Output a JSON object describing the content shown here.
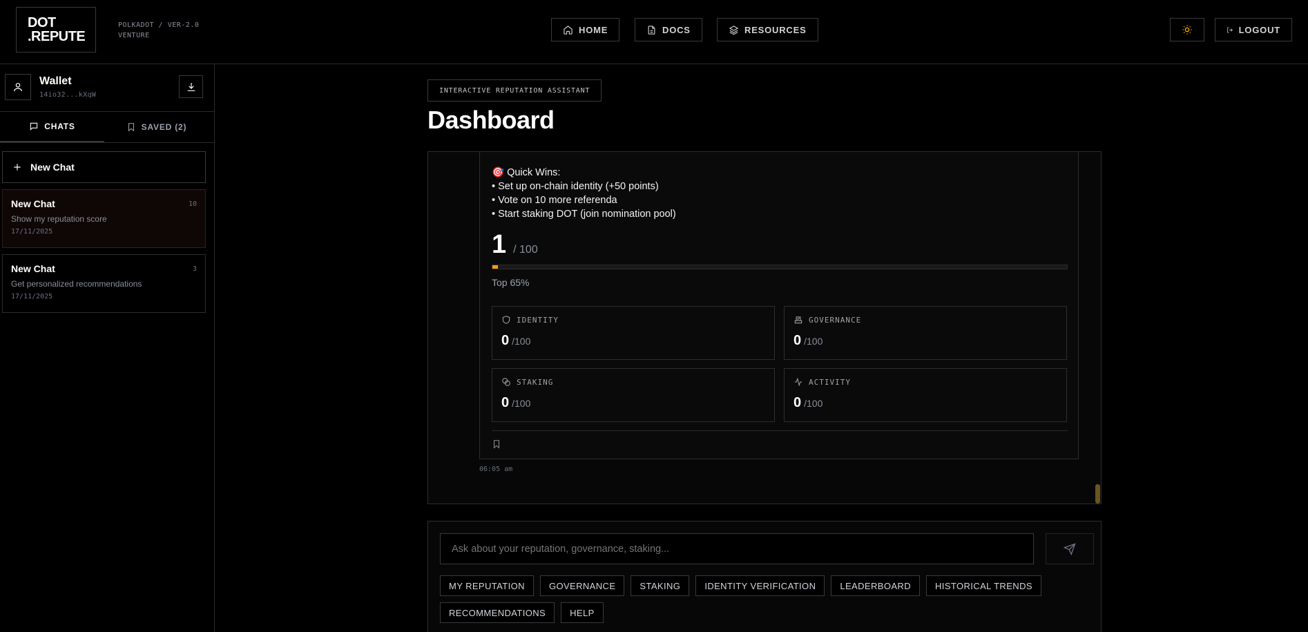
{
  "brand": {
    "line1": "DOT",
    "line2": ".REPUTE",
    "sub1": "POLKADOT / VER-2.0",
    "sub2": "VENTURE"
  },
  "nav": {
    "home": "HOME",
    "docs": "DOCS",
    "resources": "RESOURCES",
    "logout": "LOGOUT"
  },
  "wallet": {
    "title": "Wallet",
    "address": "14io32...kXqW"
  },
  "tabs": {
    "chats": "CHATS",
    "saved": "SAVED (2)"
  },
  "new_chat": "New Chat",
  "chats": [
    {
      "title": "New Chat",
      "subtitle": "Show my reputation score",
      "date": "17/11/2025",
      "count": "10"
    },
    {
      "title": "New Chat",
      "subtitle": "Get personalized recommendations",
      "date": "17/11/2025",
      "count": "3"
    }
  ],
  "main": {
    "badge": "INTERACTIVE REPUTATION ASSISTANT",
    "title": "Dashboard"
  },
  "message": {
    "quick_wins_title": "🎯 Quick Wins:",
    "quick_wins": [
      "• Set up on-chain identity (+50 points)",
      "• Vote on 10 more referenda",
      "• Start staking DOT (join nomination pool)"
    ],
    "score": "1",
    "score_max": "/ 100",
    "score_fraction": 0.01,
    "rank": "Top 65%",
    "categories": [
      {
        "label": "IDENTITY",
        "value": "0",
        "max": "/100",
        "icon": "shield-icon"
      },
      {
        "label": "GOVERNANCE",
        "value": "0",
        "max": "/100",
        "icon": "vote-icon"
      },
      {
        "label": "STAKING",
        "value": "0",
        "max": "/100",
        "icon": "coins-icon"
      },
      {
        "label": "ACTIVITY",
        "value": "0",
        "max": "/100",
        "icon": "activity-icon"
      }
    ],
    "time": "06:05 am"
  },
  "composer": {
    "placeholder": "Ask about your reputation, governance, staking...",
    "chips": [
      "MY REPUTATION",
      "GOVERNANCE",
      "STAKING",
      "IDENTITY VERIFICATION",
      "LEADERBOARD",
      "HISTORICAL TRENDS",
      "RECOMMENDATIONS",
      "HELP"
    ]
  },
  "colors": {
    "accent": "#f59e0b",
    "background": "#000000",
    "border": "#2e2e2e"
  }
}
